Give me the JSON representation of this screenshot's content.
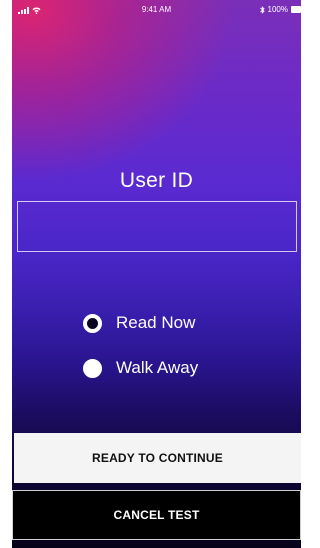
{
  "status_bar": {
    "time": "9:41 AM",
    "battery_percent": "100%",
    "icons": [
      "signal-icon",
      "wifi-icon",
      "bluetooth-icon",
      "battery-icon"
    ]
  },
  "form": {
    "user_id_label": "User ID",
    "user_id_value": "",
    "user_id_placeholder": ""
  },
  "mode_options": [
    {
      "label": "Read Now",
      "selected": true
    },
    {
      "label": "Walk Away",
      "selected": false
    }
  ],
  "actions": {
    "continue_label": "READY TO CONTINUE",
    "cancel_label": "CANCEL TEST"
  },
  "colors": {
    "gradient_top": "#7b2fb8",
    "gradient_accent": "#e1236e",
    "gradient_bottom": "#070218",
    "continue_bg": "#f4f4f4",
    "cancel_bg": "#000000"
  }
}
